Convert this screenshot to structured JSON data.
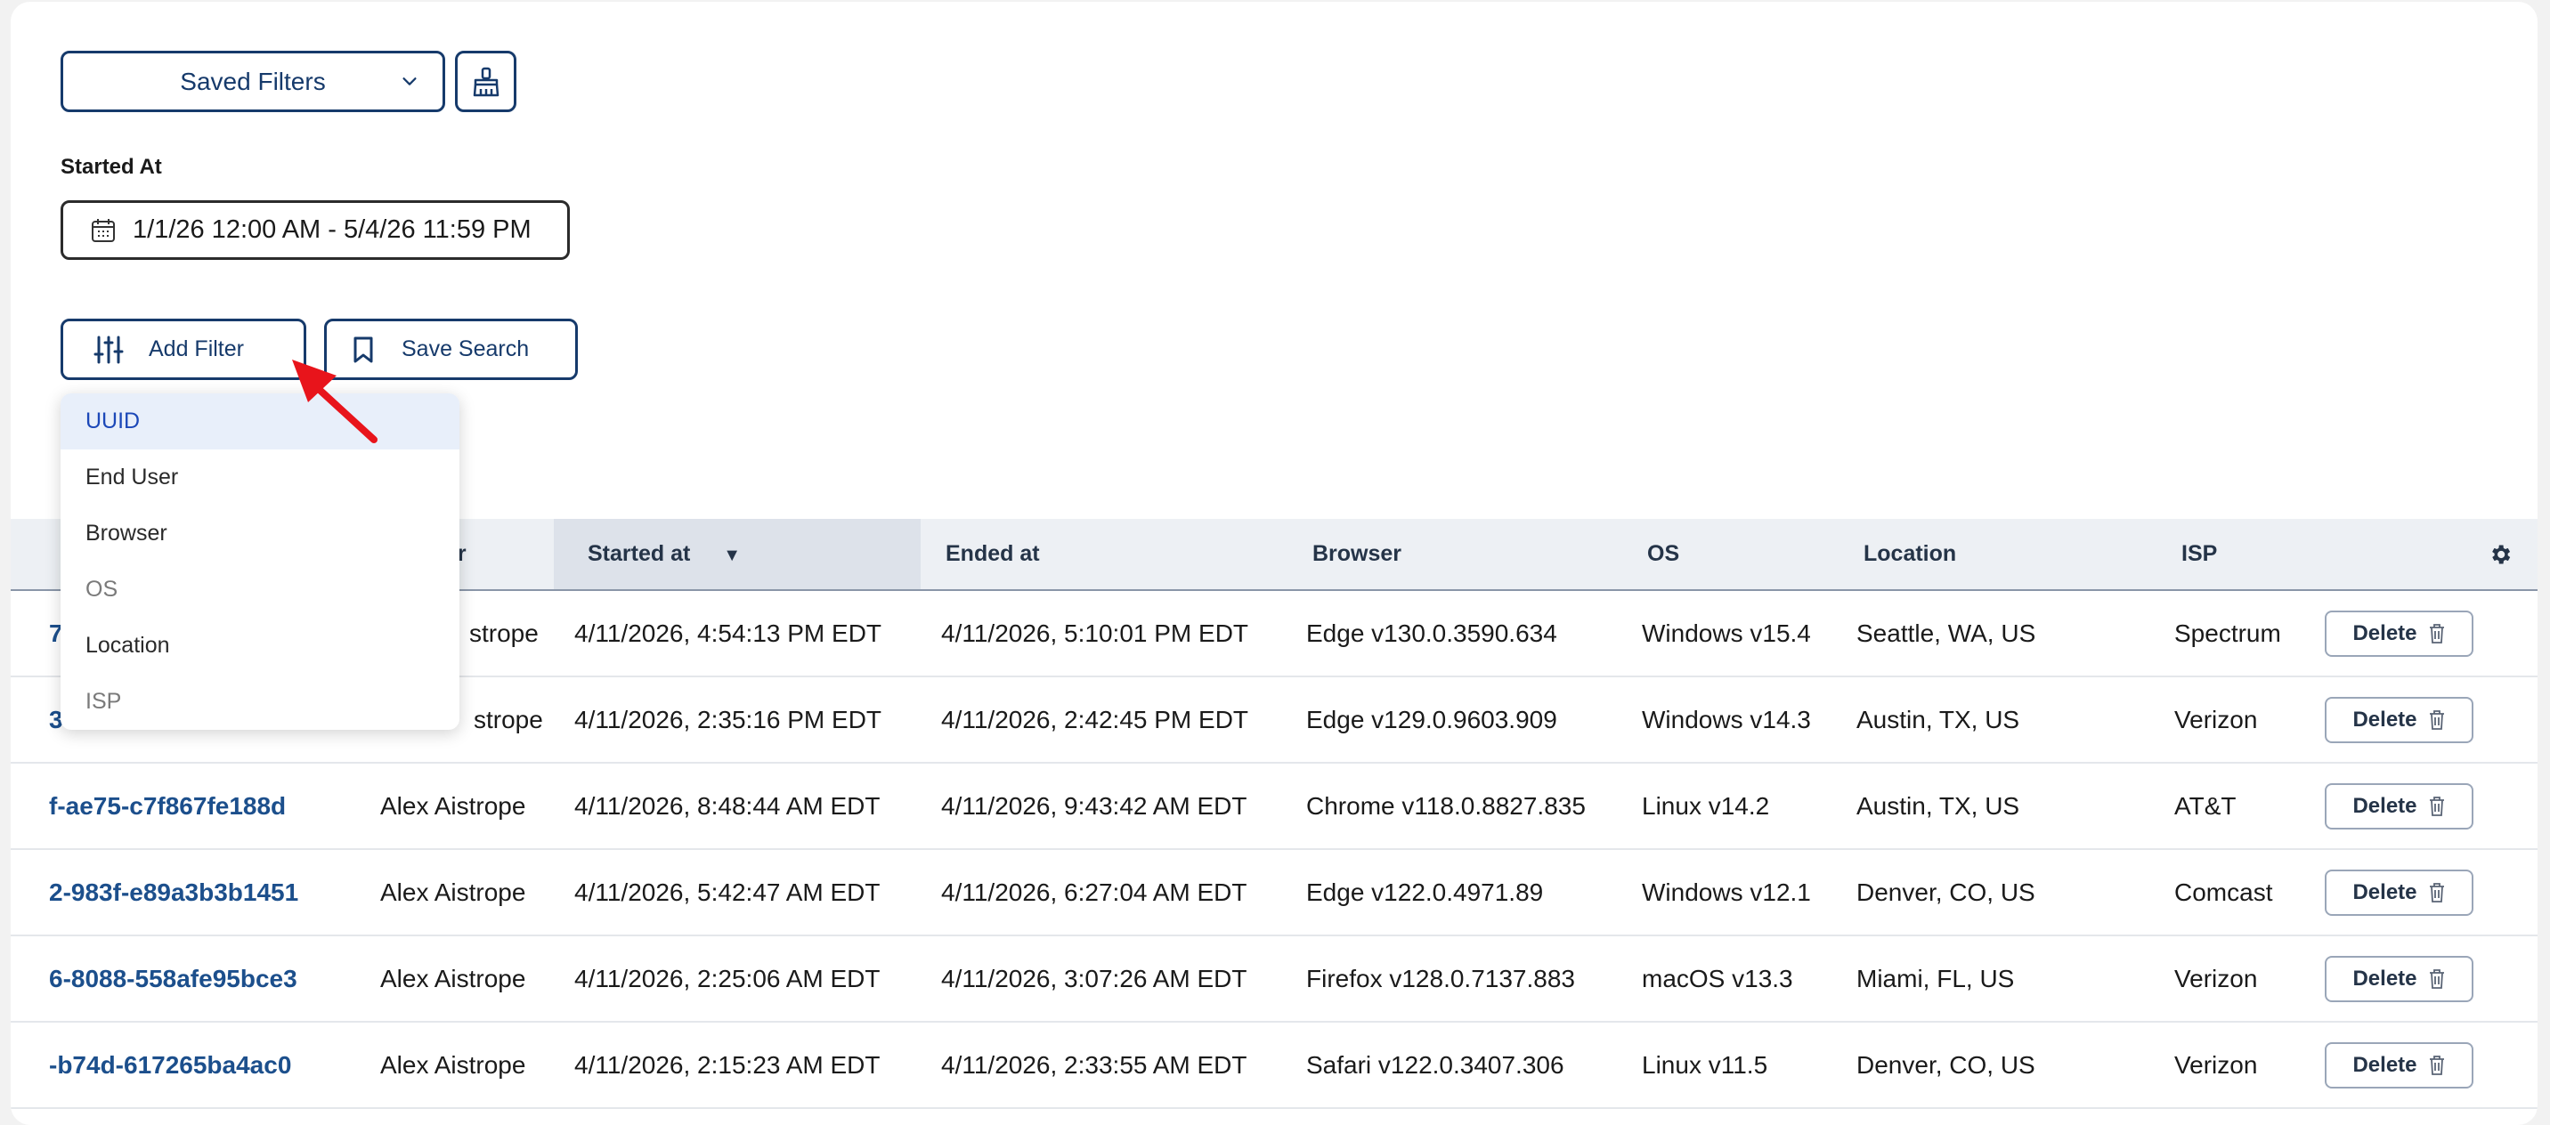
{
  "filters": {
    "saved_filters_label": "Saved Filters",
    "started_at_label": "Started At",
    "date_range_value": "1/1/26 12:00 AM - 5/4/26 11:59 PM",
    "add_filter_label": "Add Filter",
    "save_search_label": "Save Search"
  },
  "dropdown": {
    "items": [
      "UUID",
      "End User",
      "Browser",
      "OS",
      "Location",
      "ISP"
    ]
  },
  "table": {
    "headers": {
      "end_user_partial": "er",
      "started_at": "Started at",
      "ended_at": "Ended at",
      "browser": "Browser",
      "os": "OS",
      "location": "Location",
      "isp": "ISP"
    },
    "sort_indicator": "▼",
    "delete_label": "Delete",
    "rows": [
      {
        "uuid": "7-",
        "user": "Alex Aistrope",
        "user_partial": "strope",
        "started": "4/11/2026, 4:54:13 PM EDT",
        "ended": "4/11/2026, 5:10:01 PM EDT",
        "browser": "Edge v130.0.3590.634",
        "os": "Windows v15.4",
        "location": "Seattle, WA, US",
        "isp": "Spectrum"
      },
      {
        "uuid": "3-",
        "user": "Alex Aistrope",
        "user_partial": "strope",
        "started": "4/11/2026, 2:35:16 PM EDT",
        "ended": "4/11/2026, 2:42:45 PM EDT",
        "browser": "Edge v129.0.9603.909",
        "os": "Windows v14.3",
        "location": "Austin, TX, US",
        "isp": "Verizon"
      },
      {
        "uuid": "f-ae75-c7f867fe188d",
        "user": "Alex Aistrope",
        "started": "4/11/2026, 8:48:44 AM EDT",
        "ended": "4/11/2026, 9:43:42 AM EDT",
        "browser": "Chrome v118.0.8827.835",
        "os": "Linux v14.2",
        "location": "Austin, TX, US",
        "isp": "AT&T"
      },
      {
        "uuid": "2-983f-e89a3b3b1451",
        "user": "Alex Aistrope",
        "started": "4/11/2026, 5:42:47 AM EDT",
        "ended": "4/11/2026, 6:27:04 AM EDT",
        "browser": "Edge v122.0.4971.89",
        "os": "Windows v12.1",
        "location": "Denver, CO, US",
        "isp": "Comcast"
      },
      {
        "uuid": "6-8088-558afe95bce3",
        "user": "Alex Aistrope",
        "started": "4/11/2026, 2:25:06 AM EDT",
        "ended": "4/11/2026, 3:07:26 AM EDT",
        "browser": "Firefox v128.0.7137.883",
        "os": "macOS v13.3",
        "location": "Miami, FL, US",
        "isp": "Verizon"
      },
      {
        "uuid": "-b74d-617265ba4ac0",
        "user": "Alex Aistrope",
        "started": "4/11/2026, 2:15:23 AM EDT",
        "ended": "4/11/2026, 2:33:55 AM EDT",
        "browser": "Safari v122.0.3407.306",
        "os": "Linux v11.5",
        "location": "Denver, CO, US",
        "isp": "Verizon"
      }
    ]
  },
  "colors": {
    "primary": "#163a6b",
    "link": "#1c4f8c",
    "header_bg": "#edf0f4",
    "annotation_arrow": "#e8141b"
  }
}
